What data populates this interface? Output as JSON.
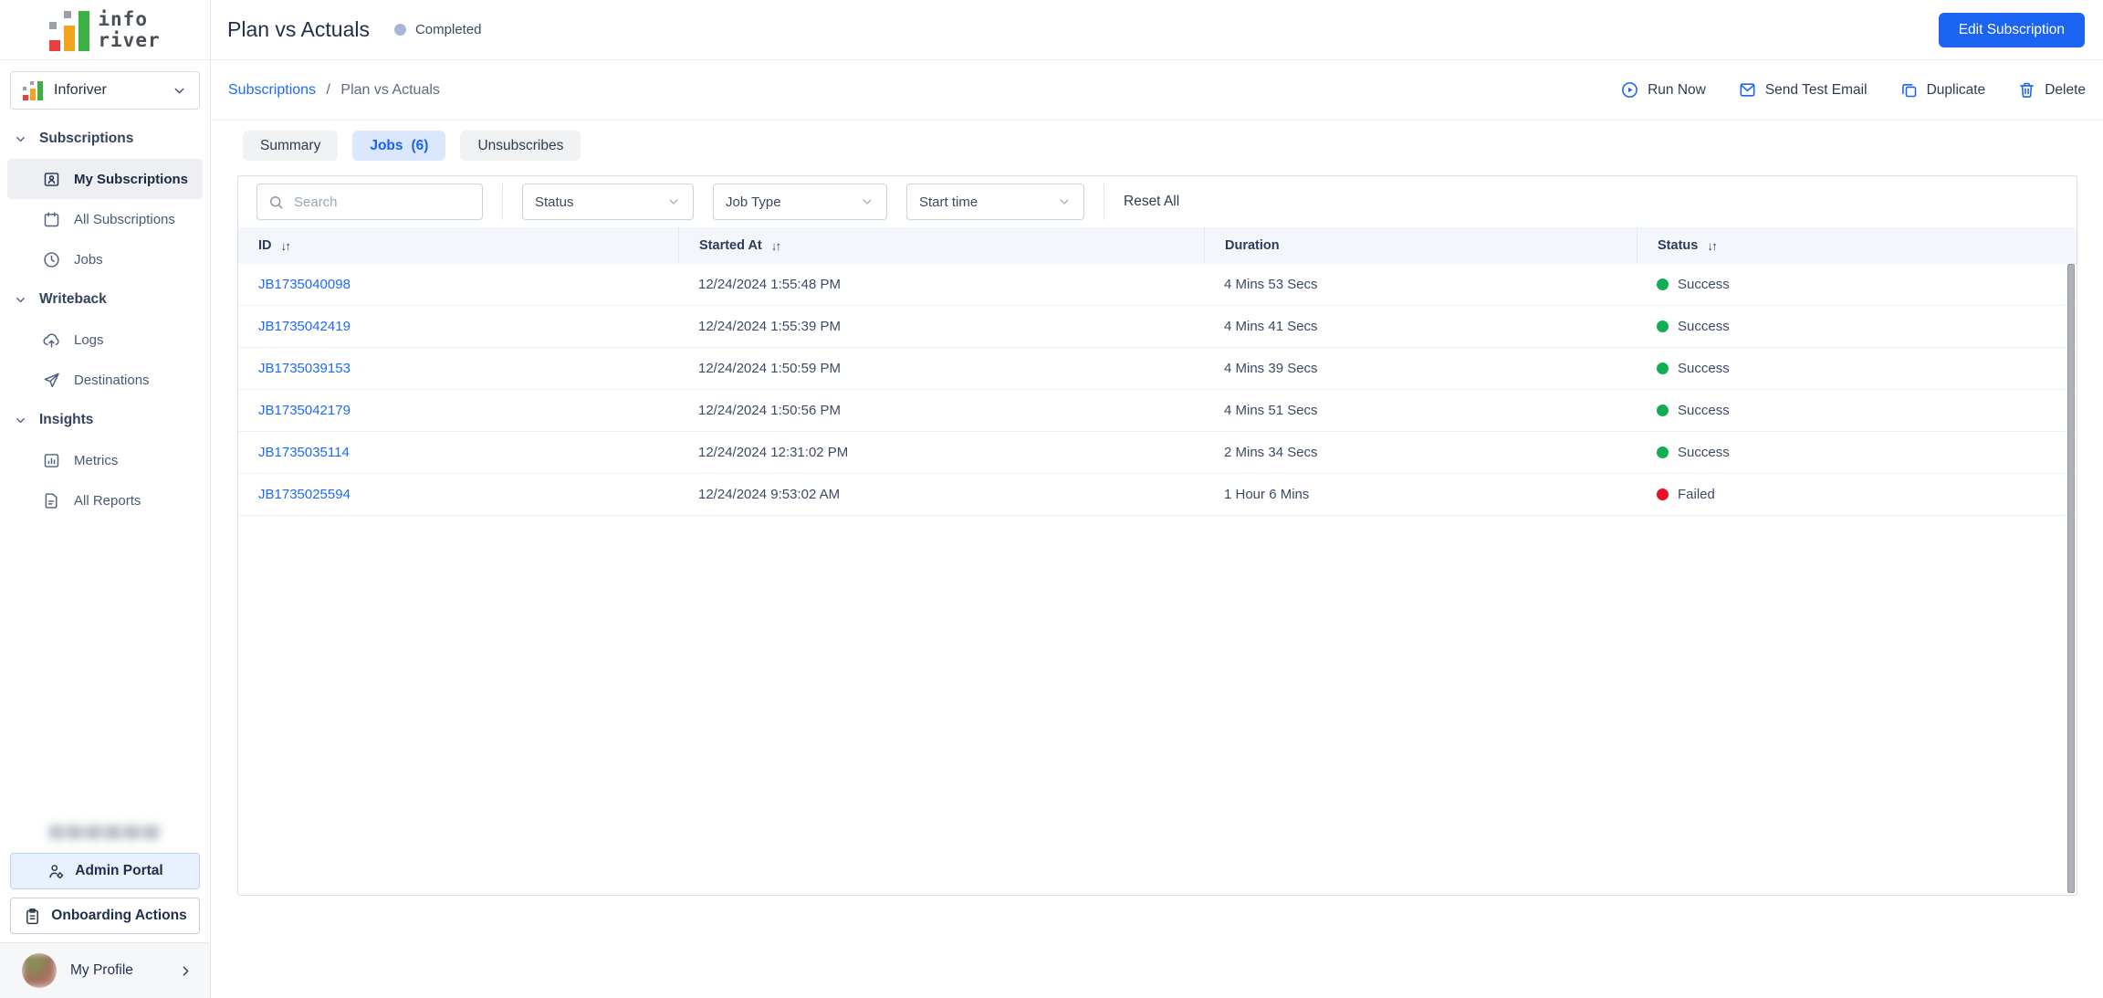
{
  "colors": {
    "accent_blue": "#1b64f2",
    "link_blue": "#1e6bf3",
    "success_green": "#13ad53",
    "failed_red": "#e81123",
    "completed_gray_blue": "#a8b7d4"
  },
  "brand": {
    "logo_line1": "info",
    "logo_line2": "river"
  },
  "sidebar": {
    "workspace_label": "Inforiver",
    "sections": [
      {
        "label": "Subscriptions",
        "items": [
          {
            "label": "My Subscriptions",
            "icon": "badge-user-icon",
            "active": true
          },
          {
            "label": "All Subscriptions",
            "icon": "calendar-icon",
            "active": false
          },
          {
            "label": "Jobs",
            "icon": "clock-icon",
            "active": false
          }
        ]
      },
      {
        "label": "Writeback",
        "items": [
          {
            "label": "Logs",
            "icon": "cloud-upload-icon",
            "active": false
          },
          {
            "label": "Destinations",
            "icon": "paper-plane-icon",
            "active": false
          }
        ]
      },
      {
        "label": "Insights",
        "items": [
          {
            "label": "Metrics",
            "icon": "bar-chart-icon",
            "active": false
          },
          {
            "label": "All Reports",
            "icon": "document-icon",
            "active": false
          }
        ]
      }
    ],
    "admin_portal_label": "Admin Portal",
    "onboarding_label": "Onboarding Actions",
    "profile_label": "My Profile"
  },
  "header": {
    "title": "Plan vs Actuals",
    "status_badge": "Completed",
    "edit_button_label": "Edit Subscription"
  },
  "breadcrumb": {
    "parent": "Subscriptions",
    "separator": "/",
    "current": "Plan vs Actuals"
  },
  "actions": {
    "run_now": "Run Now",
    "send_test_email": "Send Test Email",
    "duplicate": "Duplicate",
    "delete": "Delete"
  },
  "tabs": {
    "summary": "Summary",
    "jobs": "Jobs",
    "jobs_count": "(6)",
    "unsubscribes": "Unsubscribes"
  },
  "filters": {
    "search_placeholder": "Search",
    "status_label": "Status",
    "job_type_label": "Job Type",
    "start_time_label": "Start time",
    "reset_label": "Reset All"
  },
  "table": {
    "sort_glyph": "↓↑",
    "columns": {
      "id": "ID",
      "started_at": "Started At",
      "duration": "Duration",
      "status": "Status"
    },
    "rows": [
      {
        "id": "JB1735040098",
        "started_at": "12/24/2024 1:55:48 PM",
        "duration": "4 Mins 53 Secs",
        "status": "Success"
      },
      {
        "id": "JB1735042419",
        "started_at": "12/24/2024 1:55:39 PM",
        "duration": "4 Mins 41 Secs",
        "status": "Success"
      },
      {
        "id": "JB1735039153",
        "started_at": "12/24/2024 1:50:59 PM",
        "duration": "4 Mins 39 Secs",
        "status": "Success"
      },
      {
        "id": "JB1735042179",
        "started_at": "12/24/2024 1:50:56 PM",
        "duration": "4 Mins 51 Secs",
        "status": "Success"
      },
      {
        "id": "JB1735035114",
        "started_at": "12/24/2024 12:31:02 PM",
        "duration": "2 Mins 34 Secs",
        "status": "Success"
      },
      {
        "id": "JB1735025594",
        "started_at": "12/24/2024 9:53:02 AM",
        "duration": "1 Hour 6 Mins",
        "status": "Failed"
      }
    ]
  }
}
